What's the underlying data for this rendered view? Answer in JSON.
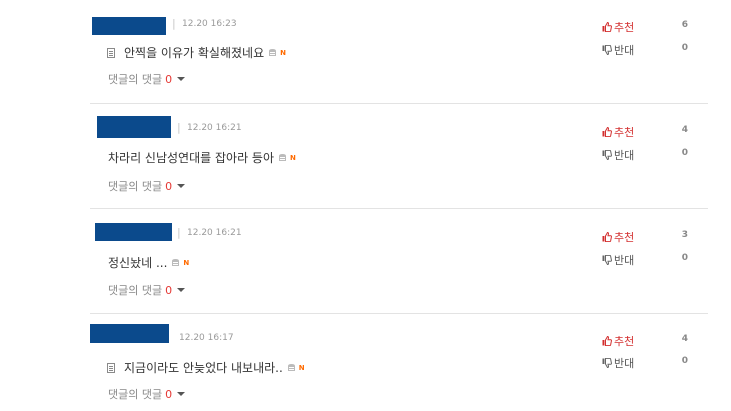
{
  "comments": [
    {
      "time": "12.20 16:23",
      "separator": "|",
      "text": "안찍을 이유가 확실해졌네요",
      "has_doc_icon": true,
      "reply_label": "댓글의 댓글",
      "reply_count": "0",
      "upvote_label": "추천",
      "upvote_count": "6",
      "downvote_label": "반대",
      "downvote_count": "0"
    },
    {
      "time": "12.20 16:21",
      "separator": "|",
      "text": "차라리 신남성연대를 잡아라 등아",
      "has_doc_icon": false,
      "reply_label": "댓글의 댓글",
      "reply_count": "0",
      "upvote_label": "추천",
      "upvote_count": "4",
      "downvote_label": "반대",
      "downvote_count": "0"
    },
    {
      "time": "12.20 16:21",
      "separator": "|",
      "text": "정신놨네 ...",
      "has_doc_icon": false,
      "reply_label": "댓글의 댓글",
      "reply_count": "0",
      "upvote_label": "추천",
      "upvote_count": "3",
      "downvote_label": "반대",
      "downvote_count": "0"
    },
    {
      "time": "12.20 16:17",
      "separator": "",
      "text": "지금이라도 안늦었다 내보내라..",
      "has_doc_icon": true,
      "reply_label": "댓글의 댓글",
      "reply_count": "0",
      "upvote_label": "추천",
      "upvote_count": "4",
      "downvote_label": "반대",
      "downvote_count": "0"
    }
  ],
  "badge": {
    "new": "N"
  },
  "colors": {
    "name_block": "#0b4a8c",
    "upvote": "#d32f2f",
    "reply_count": "#e53935",
    "new_badge": "#ff6a00"
  }
}
